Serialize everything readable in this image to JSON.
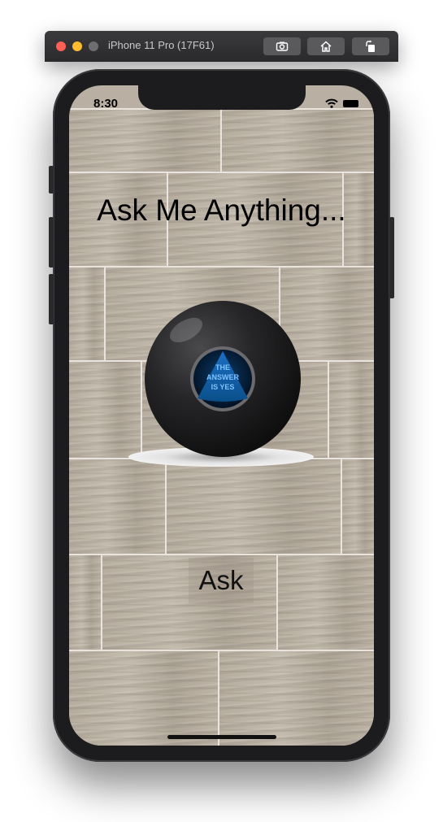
{
  "window": {
    "title": "iPhone 11 Pro (17F61)",
    "buttons": [
      "screenshot-icon",
      "home-icon",
      "rotate-icon"
    ]
  },
  "status_bar": {
    "time": "8:30",
    "icons": [
      "wifi-icon",
      "battery-icon"
    ]
  },
  "main": {
    "heading": "Ask Me Anything...",
    "ball": {
      "answer_lines": [
        "THE",
        "ANSWER",
        "IS YES"
      ],
      "window_color": "#0a4f8a"
    },
    "ask_button_label": "Ask"
  },
  "colors": {
    "wood": "#b9b0a3",
    "grout": "#e9e5de",
    "device": "#1c1c1e"
  }
}
